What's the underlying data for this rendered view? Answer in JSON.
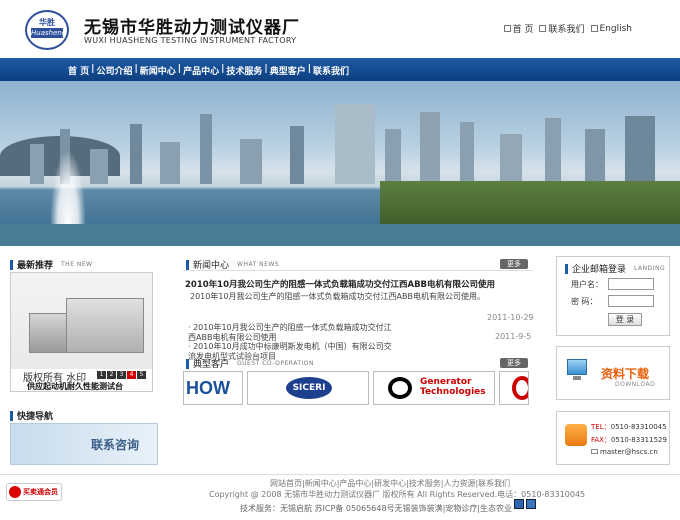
{
  "header": {
    "logo_top": "华胜",
    "logo_band": "Huasheng",
    "company_cn": "无锡市华胜动力测试仪器厂",
    "company_en": "WUXI HUASHENG TESTING INSTRUMENT FACTORY",
    "links": {
      "home": "首 页",
      "contact": "联系我们",
      "english": "English"
    }
  },
  "nav": {
    "items": [
      "首 页",
      "公司介绍",
      "新闻中心",
      "产品中心",
      "技术服务",
      "典型客户",
      "联系我们"
    ]
  },
  "left": {
    "latest_title": "最新推荐",
    "latest_en": "THE NEW",
    "watermark": "版权所有 水印",
    "product_name": "供应起动机耐久性能测试台",
    "pager": [
      "1",
      "2",
      "3",
      "4",
      "5"
    ],
    "quicknav_title": "快捷导航",
    "quicknav_label": "联系咨询"
  },
  "news": {
    "title": "新闻中心",
    "title_en": "WHAT NEWS",
    "more": "更多",
    "headline": "2010年10月我公司生产的阻感一体式负载箱成功交付江西ABB电机有限公司使用",
    "summary": "2010年10月我公司生产的阻感一体式负载箱成功交付江西ABB电机有限公司使用。",
    "date1": "2011-10-29",
    "item1_l1": "· 2010年10月我公司生产的阻感一体式负载箱成功交付江",
    "item1_l2": "西ABB电机有限公司使用",
    "date2": "2011-9-5",
    "item2_l1": "· 2010年10月成功中标康明斯发电机（中国）有限公司交",
    "item2_l2": "流发电机型式试验台项目"
  },
  "coop": {
    "title": "典型客户",
    "title_en": "GUEST CO-OPERATION",
    "more": "更多",
    "logos": [
      "HOW",
      "SICERI",
      "Generator",
      "Technologies"
    ]
  },
  "login": {
    "title": "企业邮箱登录",
    "title_en": "LANDING",
    "user_label": "用户名：",
    "pwd_label": "密  码：",
    "button": "登 录"
  },
  "download": {
    "title": "资料下载",
    "title_en": "DOWNLOAD"
  },
  "contact": {
    "tel_label": "TEL：",
    "tel": "0510-83310045",
    "fax_label": "FAX：",
    "fax": "0510-83311529",
    "email": "master@hscs.cn"
  },
  "footer": {
    "links": "网站首页|新闻中心|产品中心|研发中心|技术服务|人力资源|联系我们",
    "copyright": "Copyright @ 2008 无锡市华胜动力测试仪器厂 版权所有 All Rights Reserved.电话：0510-83310045",
    "support": "技术服务：无锡启航 苏ICP备 05065648号无锡装饰装潢|宠物诊疗|生态农业",
    "badge": "买卖通会员"
  },
  "colors": {
    "nav": "#1e5aa2",
    "accent_orange": "#e8600a",
    "section_bar": "#1a5aa8"
  }
}
